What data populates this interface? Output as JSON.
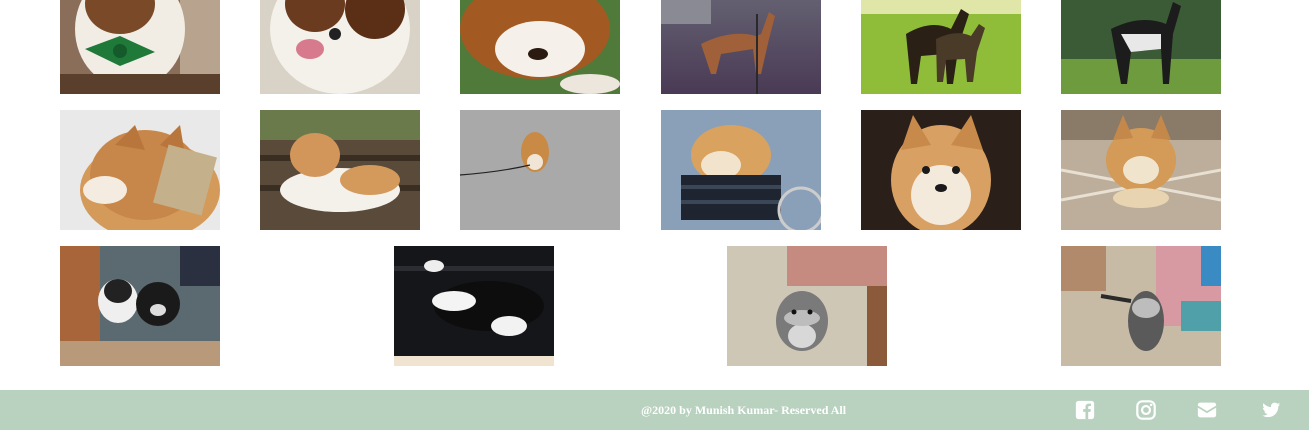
{
  "gallery": {
    "rows": [
      [
        {
          "name": "photo-saint-bernard-bowtie",
          "alt": "saint bernard with green bow tie"
        },
        {
          "name": "photo-saint-bernard-tongue",
          "alt": "saint bernard with tongue out"
        },
        {
          "name": "photo-saint-bernard-lying",
          "alt": "saint bernard lying on grass"
        },
        {
          "name": "photo-saluki-street",
          "alt": "saluki on street at dusk"
        },
        {
          "name": "photo-salukis-grass",
          "alt": "two salukis in sunny field"
        },
        {
          "name": "photo-saluki-standing",
          "alt": "black and white saluki standing"
        }
      ],
      [
        {
          "name": "photo-shiba-scarf",
          "alt": "shiba inu with scarf"
        },
        {
          "name": "photo-shiba-bench",
          "alt": "shiba inu on bench"
        },
        {
          "name": "photo-shiba-pavement",
          "alt": "shiba inu on pavement"
        },
        {
          "name": "photo-shiba-basket",
          "alt": "shiba inu in bike basket"
        },
        {
          "name": "photo-shiba-portrait",
          "alt": "shiba inu portrait"
        },
        {
          "name": "photo-shiba-cushion",
          "alt": "shiba inu on cushion"
        }
      ],
      [
        {
          "name": "photo-shih-tzus-doorway",
          "alt": "two shih tzus in doorway"
        },
        {
          "name": "photo-shih-tzu-sofa",
          "alt": "shih tzu sleeping on sofa"
        },
        {
          "name": "photo-schnauzer-rug",
          "alt": "schnauzer on rug"
        },
        {
          "name": "photo-schnauzer-room",
          "alt": "schnauzer in living room"
        }
      ]
    ]
  },
  "footer": {
    "copyright": "@2020 by Munish Kumar- Reserved All",
    "social": [
      {
        "name": "facebook-icon",
        "label": "Facebook"
      },
      {
        "name": "instagram-icon",
        "label": "Instagram"
      },
      {
        "name": "email-icon",
        "label": "Email"
      },
      {
        "name": "twitter-icon",
        "label": "Twitter"
      }
    ],
    "background_color": "#b9d1bf",
    "text_color": "#ffffff"
  }
}
